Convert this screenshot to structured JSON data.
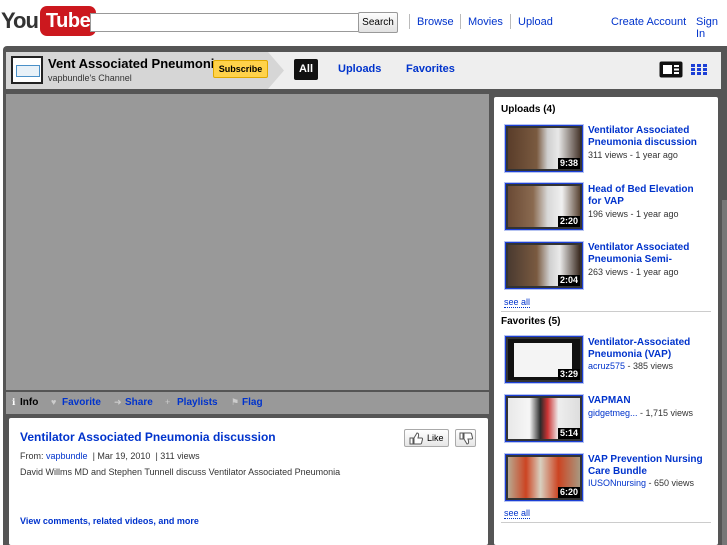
{
  "topbar": {
    "logo_you": "You",
    "logo_tube": "Tube",
    "search_placeholder": "",
    "search_button": "Search",
    "nav": [
      "Browse",
      "Movies",
      "Upload"
    ],
    "create_account": "Create Account",
    "sign_in": "Sign In"
  },
  "channel": {
    "title": "Vent Associated Pneumonia",
    "subtitle": "vapbundle's Channel",
    "subscribe_label": "Subscribe",
    "tabs": [
      "All",
      "Uploads",
      "Favorites"
    ],
    "view_icons": [
      "player-view-icon",
      "grid-view-icon"
    ]
  },
  "actions": {
    "info": "Info",
    "favorite": "Favorite",
    "share": "Share",
    "playlists": "Playlists",
    "flag": "Flag"
  },
  "info": {
    "title": "Ventilator Associated Pneumonia discussion",
    "from_label": "From:",
    "from_user": "vapbundle",
    "date": "Mar 19, 2010",
    "views": "311 views",
    "description": "David Willms MD and Stephen Tunnell discuss Ventilator Associated Pneumonia",
    "more_link": "View comments, related videos, and more",
    "like_label": "Like"
  },
  "sidebar": {
    "uploads_heading": "Uploads (4)",
    "uploads": [
      {
        "title": "Ventilator Associated Pneumonia discussion",
        "meta": "311 views - 1 year ago",
        "duration": "9:38"
      },
      {
        "title": "Head of Bed Elevation for VAP",
        "meta": "196 views - 1 year ago",
        "duration": "2:20"
      },
      {
        "title": "Ventilator Associated Pneumonia Semi-",
        "meta": "263 views - 1 year ago",
        "duration": "2:04"
      }
    ],
    "uploads_see_all": "see all",
    "favorites_heading": "Favorites (5)",
    "favorites": [
      {
        "title": "Ventilator-Associated Pneumonia (VAP)",
        "user": "acruz575",
        "views": " - 385 views",
        "duration": "3:29"
      },
      {
        "title": "VAPMAN",
        "user": "gidgetmeg...",
        "views": " - 1,715 views",
        "duration": "5:14"
      },
      {
        "title": "VAP Prevention Nursing Care Bundle",
        "user": "IUSONnursing",
        "views": " - 650 views",
        "duration": "6:20"
      }
    ],
    "favorites_see_all": "see all"
  }
}
